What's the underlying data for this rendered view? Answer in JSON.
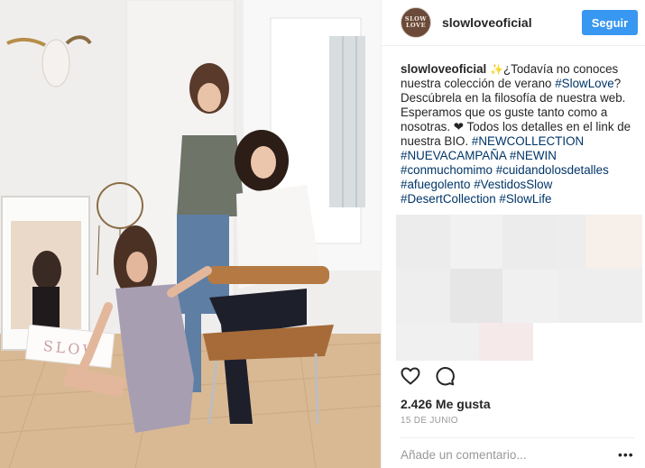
{
  "post": {
    "username": "slowloveoficial",
    "avatar_text": [
      "SLOW",
      "LOVE"
    ],
    "follow_label": "Seguir",
    "caption": {
      "username": "slowloveoficial",
      "sparkle": "✨",
      "text_1": "¿Todavía no conoces nuestra colección de verano ",
      "tag_1": "#SlowLove",
      "text_2": "? Descúbrela en la filosofía de nuestra web. Esperamos que os guste tanto como a nosotras. ❤ Todos los detalles en el link de nuestra BIO. ",
      "tags": [
        "#NEWCOLLECTION",
        "#NUEVACAMPAÑA",
        "#NEWIN",
        "#conmuchomimo",
        "#cuidandolosdetalles",
        "#afuegolento",
        "#VestidosSlow",
        "#DesertCollection",
        "#SlowLife"
      ]
    },
    "likes": "2.426 Me gusta",
    "date": "15 DE JUNIO",
    "comment_placeholder": "Añade un comentario...",
    "more_options": "•••",
    "photo_sign": "SLOW"
  },
  "colors": {
    "accent": "#3897f0",
    "hashtag": "#003569",
    "muted": "#999999"
  }
}
